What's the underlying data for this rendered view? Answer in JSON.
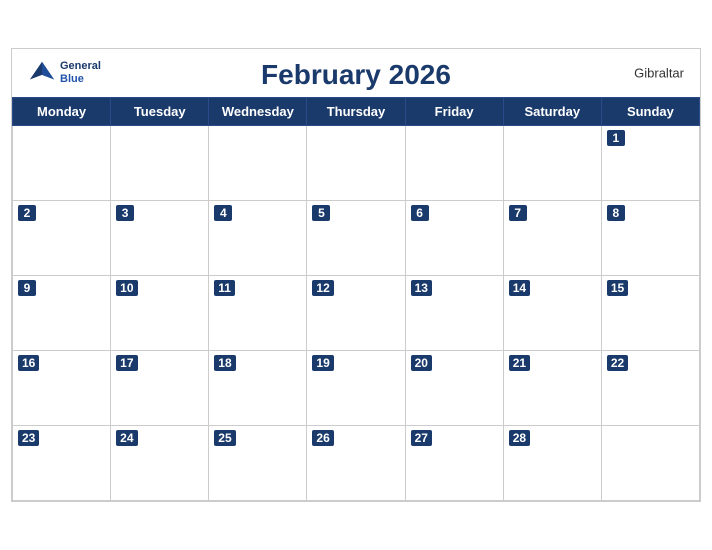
{
  "header": {
    "title": "February 2026",
    "country": "Gibraltar",
    "logo_general": "General",
    "logo_blue": "Blue"
  },
  "days_of_week": [
    "Monday",
    "Tuesday",
    "Wednesday",
    "Thursday",
    "Friday",
    "Saturday",
    "Sunday"
  ],
  "weeks": [
    [
      null,
      null,
      null,
      null,
      null,
      null,
      1
    ],
    [
      2,
      3,
      4,
      5,
      6,
      7,
      8
    ],
    [
      9,
      10,
      11,
      12,
      13,
      14,
      15
    ],
    [
      16,
      17,
      18,
      19,
      20,
      21,
      22
    ],
    [
      23,
      24,
      25,
      26,
      27,
      28,
      null
    ]
  ]
}
